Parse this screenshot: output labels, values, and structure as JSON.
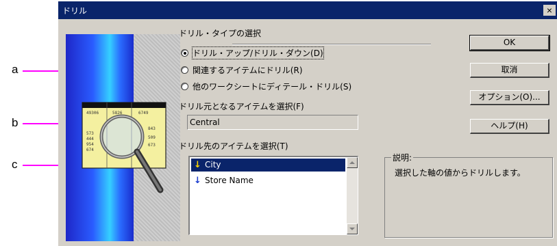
{
  "callouts": {
    "a": "a",
    "b": "b",
    "c": "c"
  },
  "dialog": {
    "title": "ドリル",
    "close_glyph": "×"
  },
  "drill_type": {
    "heading": "ドリル・タイプの選択",
    "options": [
      {
        "label": "ドリル・アップ/ドリル・ダウン(D)",
        "selected": true
      },
      {
        "label": "関連するアイテムにドリル(R)",
        "selected": false
      },
      {
        "label": "他のワークシートにディテール・ドリル(S)",
        "selected": false
      }
    ]
  },
  "source_item": {
    "label": "ドリル元となるアイテムを選択(F)",
    "value": "Central"
  },
  "target_item": {
    "label": "ドリル先のアイテムを選択(T)",
    "items": [
      {
        "text": "City",
        "icon": "arrow-down-icon",
        "selected": true
      },
      {
        "text": "Store Name",
        "icon": "arrow-down-icon",
        "selected": false
      }
    ]
  },
  "description": {
    "title": "説明:",
    "text": "選択した軸の値からドリルします。"
  },
  "buttons": {
    "ok": "OK",
    "cancel": "取消",
    "options": "オプション(O)...",
    "help": "ヘルプ(H)"
  },
  "colors": {
    "titlebar": "#0a246a",
    "dialog_bg": "#d4d0c8",
    "callout_line": "#ff00ff",
    "selection": "#0a246a"
  }
}
